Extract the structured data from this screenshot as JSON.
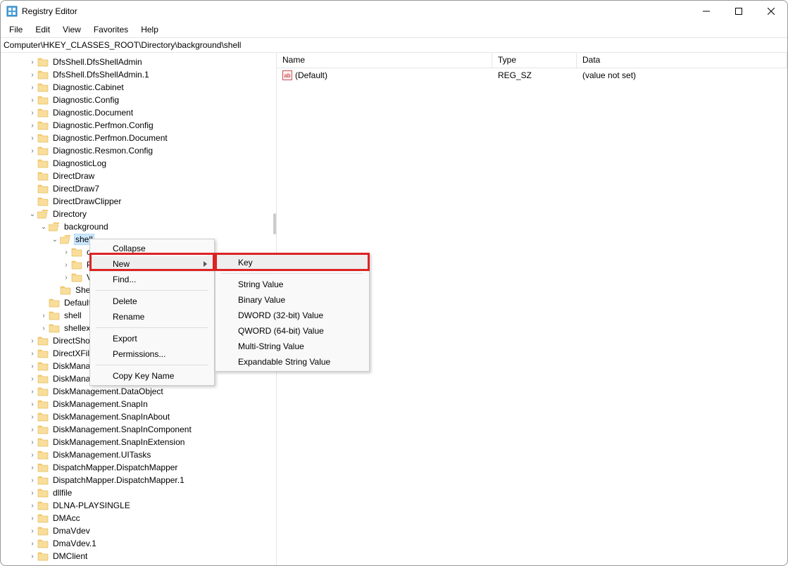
{
  "window": {
    "title": "Registry Editor"
  },
  "menubar": [
    "File",
    "Edit",
    "View",
    "Favorites",
    "Help"
  ],
  "pathbar": "Computer\\HKEY_CLASSES_ROOT\\Directory\\background\\shell",
  "tree": [
    {
      "d": 2,
      "c": ">",
      "l": "DfsShell.DfsShellAdmin"
    },
    {
      "d": 2,
      "c": ">",
      "l": "DfsShell.DfsShellAdmin.1"
    },
    {
      "d": 2,
      "c": ">",
      "l": "Diagnostic.Cabinet"
    },
    {
      "d": 2,
      "c": ">",
      "l": "Diagnostic.Config"
    },
    {
      "d": 2,
      "c": ">",
      "l": "Diagnostic.Document"
    },
    {
      "d": 2,
      "c": ">",
      "l": "Diagnostic.Perfmon.Config"
    },
    {
      "d": 2,
      "c": ">",
      "l": "Diagnostic.Perfmon.Document"
    },
    {
      "d": 2,
      "c": ">",
      "l": "Diagnostic.Resmon.Config"
    },
    {
      "d": 2,
      "c": "",
      "l": "DiagnosticLog"
    },
    {
      "d": 2,
      "c": "",
      "l": "DirectDraw"
    },
    {
      "d": 2,
      "c": "",
      "l": "DirectDraw7"
    },
    {
      "d": 2,
      "c": "",
      "l": "DirectDrawClipper"
    },
    {
      "d": 2,
      "c": "v",
      "l": "Directory",
      "open": true
    },
    {
      "d": 3,
      "c": "v",
      "l": "background",
      "open": true
    },
    {
      "d": 4,
      "c": "v",
      "l": "shell",
      "open": true,
      "sel": true
    },
    {
      "d": 5,
      "c": ">",
      "l": "c"
    },
    {
      "d": 5,
      "c": ">",
      "l": "P"
    },
    {
      "d": 5,
      "c": ">",
      "l": "V"
    },
    {
      "d": 4,
      "c": "",
      "l": "She"
    },
    {
      "d": 3,
      "c": "",
      "l": "Default"
    },
    {
      "d": 3,
      "c": ">",
      "l": "shell"
    },
    {
      "d": 3,
      "c": ">",
      "l": "shellex"
    },
    {
      "d": 2,
      "c": ">",
      "l": "DirectSho"
    },
    {
      "d": 2,
      "c": ">",
      "l": "DirectXFil"
    },
    {
      "d": 2,
      "c": ">",
      "l": "DiskMana"
    },
    {
      "d": 2,
      "c": ">",
      "l": "DiskMana"
    },
    {
      "d": 2,
      "c": ">",
      "l": "DiskManagement.DataObject"
    },
    {
      "d": 2,
      "c": ">",
      "l": "DiskManagement.SnapIn"
    },
    {
      "d": 2,
      "c": ">",
      "l": "DiskManagement.SnapInAbout"
    },
    {
      "d": 2,
      "c": ">",
      "l": "DiskManagement.SnapInComponent"
    },
    {
      "d": 2,
      "c": ">",
      "l": "DiskManagement.SnapInExtension"
    },
    {
      "d": 2,
      "c": ">",
      "l": "DiskManagement.UITasks"
    },
    {
      "d": 2,
      "c": ">",
      "l": "DispatchMapper.DispatchMapper"
    },
    {
      "d": 2,
      "c": ">",
      "l": "DispatchMapper.DispatchMapper.1"
    },
    {
      "d": 2,
      "c": ">",
      "l": "dllfile"
    },
    {
      "d": 2,
      "c": ">",
      "l": "DLNA-PLAYSINGLE"
    },
    {
      "d": 2,
      "c": ">",
      "l": "DMAcc"
    },
    {
      "d": 2,
      "c": ">",
      "l": "DmaVdev"
    },
    {
      "d": 2,
      "c": ">",
      "l": "DmaVdev.1"
    },
    {
      "d": 2,
      "c": ">",
      "l": "DMClient"
    }
  ],
  "values": {
    "headers": {
      "name": "Name",
      "type": "Type",
      "data": "Data"
    },
    "rows": [
      {
        "icon": "ab",
        "name": "(Default)",
        "type": "REG_SZ",
        "data": "(value not set)"
      }
    ]
  },
  "ctx1": {
    "items": [
      {
        "l": "Collapse"
      },
      {
        "l": "New",
        "sub": true,
        "hover": true
      },
      {
        "l": "Find..."
      },
      {
        "sep": true
      },
      {
        "l": "Delete"
      },
      {
        "l": "Rename"
      },
      {
        "sep": true
      },
      {
        "l": "Export"
      },
      {
        "l": "Permissions..."
      },
      {
        "sep": true
      },
      {
        "l": "Copy Key Name"
      }
    ]
  },
  "ctx2": {
    "items": [
      {
        "l": "Key",
        "hover": true
      },
      {
        "sep": true
      },
      {
        "l": "String Value"
      },
      {
        "l": "Binary Value"
      },
      {
        "l": "DWORD (32-bit) Value"
      },
      {
        "l": "QWORD (64-bit) Value"
      },
      {
        "l": "Multi-String Value"
      },
      {
        "l": "Expandable String Value"
      }
    ]
  }
}
